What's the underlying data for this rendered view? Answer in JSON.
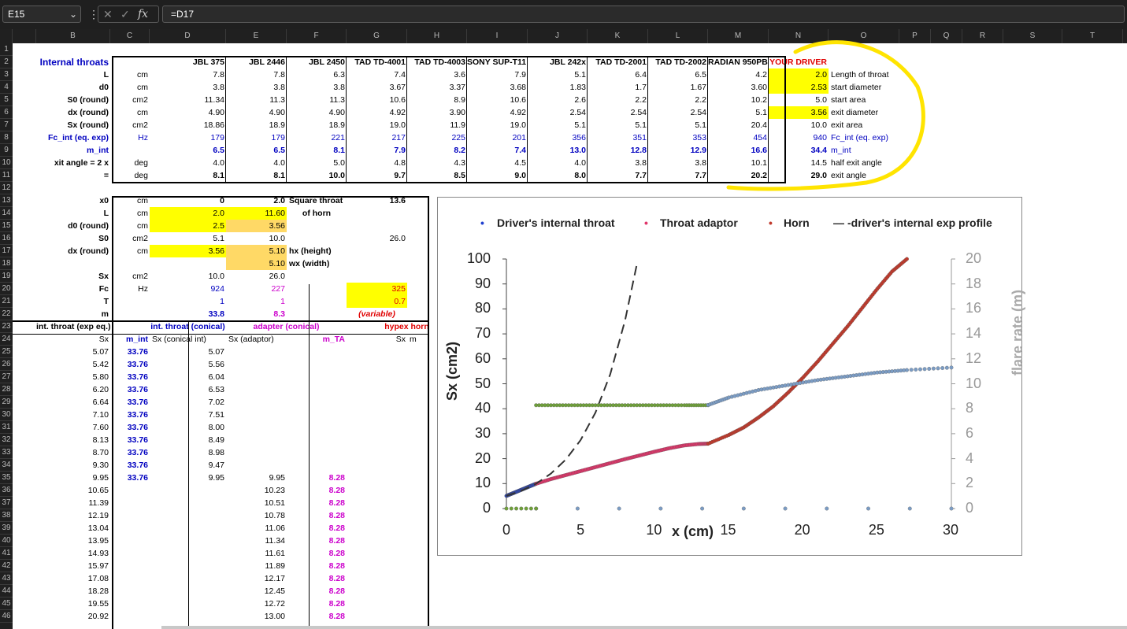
{
  "formula_bar": {
    "name_box": "E15",
    "dots": "⋮",
    "cancel": "✕",
    "enter": "✓",
    "fx": "fx",
    "formula": "=D17"
  },
  "columns": [
    {
      "label": "B",
      "w": 94
    },
    {
      "label": "C",
      "w": 50
    },
    {
      "label": "D",
      "w": 97
    },
    {
      "label": "E",
      "w": 77
    },
    {
      "label": "F",
      "w": 76
    },
    {
      "label": "G",
      "w": 77
    },
    {
      "label": "H",
      "w": 76
    },
    {
      "label": "I",
      "w": 77
    },
    {
      "label": "J",
      "w": 76
    },
    {
      "label": "K",
      "w": 77
    },
    {
      "label": "L",
      "w": 76
    },
    {
      "label": "M",
      "w": 77
    },
    {
      "label": "N",
      "w": 76
    },
    {
      "label": "O",
      "w": 90
    },
    {
      "label": "P",
      "w": 40
    },
    {
      "label": "Q",
      "w": 40
    },
    {
      "label": "R",
      "w": 52
    },
    {
      "label": "S",
      "w": 75
    },
    {
      "label": "T",
      "w": 77
    },
    {
      "label": "U",
      "w": 60
    }
  ],
  "rows": [
    "1",
    "2",
    "3",
    "4",
    "5",
    "6",
    "7",
    "8",
    "9",
    "10",
    "11",
    "12",
    "13",
    "14",
    "15",
    "16",
    "17",
    "18",
    "19",
    "20",
    "21",
    "22",
    "23",
    "24",
    "25",
    "26",
    "27",
    "28",
    "29",
    "30",
    "31",
    "32",
    "33",
    "34",
    "35",
    "36",
    "37",
    "38",
    "39",
    "40",
    "41",
    "42",
    "43",
    "44",
    "45",
    "46"
  ],
  "top_table": {
    "title": "Internal throats",
    "headers": [
      "JBL 375",
      "JBL 2446",
      "JBL 2450",
      "TAD TD-4001",
      "TAD TD-4003",
      "SONY SUP-T11",
      "JBL 242x",
      "TAD TD-2001",
      "TAD TD-2002",
      "RADIAN 950PB",
      "YOUR DRIVER"
    ],
    "rows": [
      {
        "label": "L",
        "unit": "cm",
        "vals": [
          "7.8",
          "7.8",
          "6.3",
          "7.4",
          "3.6",
          "7.9",
          "5.1",
          "6.4",
          "6.5",
          "4.2",
          "2.0"
        ],
        "note": "Length of throat"
      },
      {
        "label": "d0",
        "unit": "cm",
        "vals": [
          "3.8",
          "3.8",
          "3.8",
          "3.67",
          "3.37",
          "3.68",
          "1.83",
          "1.7",
          "1.67",
          "3.60",
          "2.53"
        ],
        "note": "start diameter"
      },
      {
        "label": "S0  (round)",
        "unit": "cm2",
        "vals": [
          "11.34",
          "11.3",
          "11.3",
          "10.6",
          "8.9",
          "10.6",
          "2.6",
          "2.2",
          "2.2",
          "10.2",
          "5.0"
        ],
        "note": "start area"
      },
      {
        "label": "dx (round)",
        "unit": "cm",
        "vals": [
          "4.90",
          "4.90",
          "4.90",
          "4.92",
          "3.90",
          "4.92",
          "2.54",
          "2.54",
          "2.54",
          "5.1",
          "3.56"
        ],
        "note": "exit diameter"
      },
      {
        "label": "Sx  (round)",
        "unit": "cm2",
        "vals": [
          "18.86",
          "18.9",
          "18.9",
          "19.0",
          "11.9",
          "19.0",
          "5.1",
          "5.1",
          "5.1",
          "20.4",
          "10.0"
        ],
        "note": "exit area"
      },
      {
        "label": "Fc_int (eq. exp)",
        "unit": "Hz",
        "vals": [
          "179",
          "179",
          "221",
          "217",
          "225",
          "201",
          "356",
          "351",
          "353",
          "454",
          "940"
        ],
        "note": "Fc_int (eq. exp)"
      },
      {
        "label": "m_int",
        "unit": "",
        "vals": [
          "6.5",
          "6.5",
          "8.1",
          "7.9",
          "8.2",
          "7.4",
          "13.0",
          "12.8",
          "12.9",
          "16.6",
          "34.4"
        ],
        "note": "m_int"
      },
      {
        "label": "xit angle = 2 x",
        "unit": "deg",
        "vals": [
          "4.0",
          "4.0",
          "5.0",
          "4.8",
          "4.3",
          "4.5",
          "4.0",
          "3.8",
          "3.8",
          "10.1",
          "14.5"
        ],
        "note": "half exit angle"
      },
      {
        "label": "=",
        "unit": "deg",
        "vals": [
          "8.1",
          "8.1",
          "10.0",
          "9.7",
          "8.5",
          "9.0",
          "8.0",
          "7.7",
          "7.7",
          "20.2",
          "29.0"
        ],
        "note": "exit angle"
      }
    ]
  },
  "mid": {
    "labels": [
      "x0",
      "L",
      "d0 (round)",
      "S0",
      "dx (round)",
      "",
      "Sx",
      "Fc",
      "T",
      "m"
    ],
    "units": [
      "cm",
      "cm",
      "cm",
      "cm2",
      "cm",
      "",
      "cm2",
      "Hz",
      "",
      ""
    ],
    "d": [
      "0",
      "2.0",
      "2.5",
      "5.1",
      "3.56",
      "",
      "10.0",
      "924",
      "1",
      "33.8"
    ],
    "e": [
      "2.0",
      "11.60",
      "3.56",
      "10.0",
      "5.10",
      "5.10",
      "26.0",
      "227",
      "1",
      "8.3"
    ],
    "f13": "Square throat",
    "f14": "of horn",
    "f17": "hx (height)",
    "f18": "wx (width)",
    "g13": "13.6",
    "g16": "26.0",
    "g20": "325",
    "g21": "0.7",
    "g22": "(variable)"
  },
  "lower": {
    "h23": [
      "int. throat (exp eq.)",
      "int. throat (conical)",
      "adapter (conical)",
      "hypex horn"
    ],
    "h24": [
      "Sx",
      "m_int",
      "Sx (conical int)",
      "Sx (adaptor)",
      "m_TA",
      "Sx",
      "m"
    ],
    "b": [
      "5.07",
      "5.42",
      "5.80",
      "6.20",
      "6.64",
      "7.10",
      "7.60",
      "8.13",
      "8.70",
      "9.30",
      "9.95",
      "10.65",
      "11.39",
      "12.19",
      "13.04",
      "13.95",
      "14.93",
      "15.97",
      "17.08",
      "18.28",
      "19.55",
      "20.92"
    ],
    "c": [
      "33.76",
      "33.76",
      "33.76",
      "33.76",
      "33.76",
      "33.76",
      "33.76",
      "33.76",
      "33.76",
      "33.76",
      "33.76"
    ],
    "d": [
      "5.07",
      "5.56",
      "6.04",
      "6.53",
      "7.02",
      "7.51",
      "8.00",
      "8.49",
      "8.98",
      "9.47",
      "9.95"
    ],
    "e": [
      "9.95",
      "10.23",
      "10.51",
      "10.78",
      "11.06",
      "11.34",
      "11.61",
      "11.89",
      "12.17",
      "12.45",
      "12.72",
      "13.00"
    ],
    "f": [
      "8.28",
      "8.28",
      "8.28",
      "8.28",
      "8.28",
      "8.28",
      "8.28",
      "8.28",
      "8.28",
      "8.28",
      "8.28",
      "8.28"
    ]
  },
  "chart_data": {
    "type": "scatter",
    "legend": [
      "Driver's internal throat",
      "Throat adaptor",
      "Horn",
      "driver's internal exp profile"
    ],
    "legend_colors": [
      "#1f3fcf",
      "#e0356a",
      "#c0392b",
      "#333333"
    ],
    "xlabel": "x (cm)",
    "ylabel": "Sx (cm2)",
    "y2label": "flare rate (m)",
    "xlim": [
      0,
      30
    ],
    "ylim": [
      0,
      100
    ],
    "y2lim": [
      0,
      20
    ],
    "xticks": [
      "0",
      "5",
      "10",
      "15",
      "20",
      "25",
      "30"
    ],
    "yticks": [
      "0",
      "10",
      "20",
      "30",
      "40",
      "50",
      "60",
      "70",
      "80",
      "90",
      "100"
    ],
    "y2ticks": [
      "0",
      "2",
      "4",
      "6",
      "8",
      "10",
      "12",
      "14",
      "16",
      "18",
      "20"
    ],
    "series": [
      {
        "name": "Driver's internal throat",
        "color": "#1f3fcf",
        "axis": "left",
        "x": [
          0,
          0.2,
          0.4,
          0.6,
          0.8,
          1.0,
          1.2,
          1.4,
          1.6,
          1.8,
          2.0
        ],
        "y": [
          5.07,
          5.56,
          6.04,
          6.53,
          7.02,
          7.51,
          8.0,
          8.49,
          8.98,
          9.47,
          9.95
        ]
      },
      {
        "name": "Throat adaptor",
        "color": "#e0356a",
        "axis": "left",
        "x": [
          2,
          3,
          4,
          5,
          6,
          7,
          8,
          9,
          10,
          11,
          12,
          13,
          13.6
        ],
        "y": [
          9.95,
          11.8,
          13.4,
          15.0,
          16.6,
          18.2,
          19.8,
          21.3,
          22.8,
          24.2,
          25.3,
          25.9,
          26.0
        ]
      },
      {
        "name": "Horn",
        "color": "#c0392b",
        "axis": "left",
        "x": [
          13.6,
          15,
          16,
          17,
          18,
          19,
          20,
          21,
          22,
          23,
          24,
          25,
          26,
          27
        ],
        "y": [
          26,
          29.5,
          32.5,
          36.5,
          41,
          46.5,
          52.5,
          59,
          66,
          73,
          80.5,
          88,
          95,
          100
        ]
      },
      {
        "name": "driver's internal exp profile",
        "color": "#333333",
        "axis": "left",
        "dashed": true,
        "x": [
          0,
          1,
          2,
          3,
          4,
          5,
          6,
          7,
          8,
          8.8
        ],
        "y": [
          5.07,
          7.1,
          9.95,
          14.0,
          19.6,
          27.4,
          38.4,
          53.8,
          75.4,
          98
        ]
      },
      {
        "name": "",
        "color": "#6fa03a",
        "axis": "right",
        "x": [
          2,
          4,
          6,
          8,
          10,
          12,
          13.6
        ],
        "y": [
          8.28,
          8.28,
          8.28,
          8.28,
          8.28,
          8.28,
          8.28
        ]
      },
      {
        "name": "",
        "color": "#7b9cc4",
        "axis": "right",
        "x": [
          13.6,
          15,
          17,
          19,
          21,
          23,
          25,
          27,
          30
        ],
        "y": [
          8.3,
          8.9,
          9.5,
          9.9,
          10.3,
          10.6,
          10.9,
          11.1,
          11.3
        ]
      },
      {
        "name": "",
        "color": "#7b9cc4",
        "axis": "right",
        "x": [
          2,
          30
        ],
        "y": [
          0,
          0
        ]
      },
      {
        "name": "",
        "color": "#6fa03a",
        "axis": "right",
        "x": [
          0,
          2
        ],
        "y": [
          0,
          0
        ]
      }
    ]
  }
}
